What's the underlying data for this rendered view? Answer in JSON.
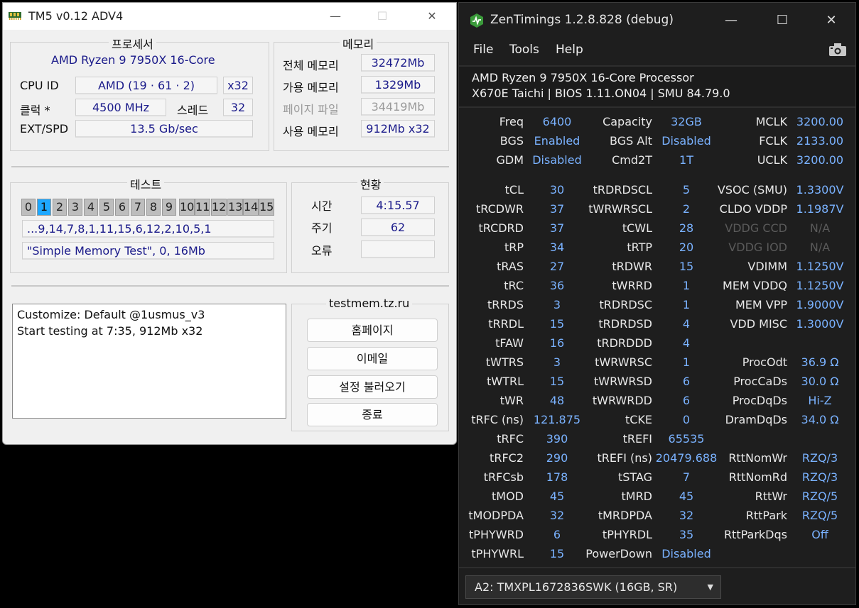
{
  "tm5": {
    "title": "TM5 v0.12 ADV4",
    "minimize": "—",
    "maximize": "☐",
    "close": "✕",
    "processor": {
      "group": "프로세서",
      "name": "AMD Ryzen 9 7950X 16-Core",
      "cpu_id_label": "CPU ID",
      "cpu_id": "AMD  (19 · 61 · 2)",
      "arch": "x32",
      "clock_label": "클럭 *",
      "clock": "4500 MHz",
      "threads_label": "스레드",
      "threads": "32",
      "ext_label": "EXT/SPD",
      "ext": "13.5 Gb/sec"
    },
    "memory": {
      "group": "메모리",
      "total_label": "전체 메모리",
      "total": "32472Mb",
      "avail_label": "가용 메모리",
      "avail": "1329Mb",
      "page_label": "페이지 파일",
      "page": "34419Mb",
      "used_label": "사용 메모리",
      "used": "912Mb x32"
    },
    "tests": {
      "group": "테스트",
      "cells": [
        "0",
        "1",
        "2",
        "3",
        "4",
        "5",
        "6",
        "7",
        "8",
        "9",
        "10",
        "11",
        "12",
        "13",
        "14",
        "15"
      ],
      "active_index": 1,
      "sequence": "...9,14,7,8,1,11,15,6,12,2,10,5,1",
      "config": "\"Simple Memory Test\", 0, 16Mb"
    },
    "status": {
      "group": "현황",
      "time_label": "시간",
      "time": "4:15.57",
      "cycle_label": "주기",
      "cycle": "62",
      "errors_label": "오류",
      "errors": ""
    },
    "log": [
      "Customize: Default @1usmus_v3",
      "Start testing at 7:35, 912Mb x32"
    ],
    "links": {
      "group": "testmem.tz.ru",
      "homepage": "홈페이지",
      "email": "이메일",
      "load_settings": "설정 불러오기",
      "exit": "종료"
    }
  },
  "zen": {
    "title": "ZenTimings 1.2.8.828 (debug)",
    "minimize": "—",
    "maximize": "☐",
    "close": "✕",
    "menu": [
      "File",
      "Tools",
      "Help"
    ],
    "cpu": "AMD Ryzen 9 7950X 16-Core Processor",
    "board": "X670E Taichi | BIOS 1.11.ON04 | SMU 84.79.0",
    "top": [
      [
        "Freq",
        "6400",
        "Capacity",
        "32GB",
        "MCLK",
        "3200.00"
      ],
      [
        "BGS",
        "Enabled",
        "BGS Alt",
        "Disabled",
        "FCLK",
        "2133.00"
      ],
      [
        "GDM",
        "Disabled",
        "Cmd2T",
        "1T",
        "UCLK",
        "3200.00"
      ]
    ],
    "timings": [
      [
        "tCL",
        "30",
        "tRDRDSCL",
        "5",
        "VSOC (SMU)",
        "1.3300V"
      ],
      [
        "tRCDWR",
        "37",
        "tWRWRSCL",
        "2",
        "CLDO VDDP",
        "1.1987V"
      ],
      [
        "tRCDRD",
        "37",
        "tCWL",
        "28",
        "VDDG CCD",
        "N/A"
      ],
      [
        "tRP",
        "34",
        "tRTP",
        "20",
        "VDDG IOD",
        "N/A"
      ],
      [
        "tRAS",
        "27",
        "tRDWR",
        "15",
        "VDIMM",
        "1.1250V"
      ],
      [
        "tRC",
        "36",
        "tWRRD",
        "1",
        "MEM VDDQ",
        "1.1250V"
      ],
      [
        "tRRDS",
        "3",
        "tRDRDSC",
        "1",
        "MEM VPP",
        "1.9000V"
      ],
      [
        "tRRDL",
        "15",
        "tRDRDSD",
        "4",
        "VDD MISC",
        "1.3000V"
      ],
      [
        "tFAW",
        "16",
        "tRDRDDD",
        "4",
        "",
        ""
      ],
      [
        "tWTRS",
        "3",
        "tWRWRSC",
        "1",
        "ProcOdt",
        "36.9 Ω"
      ],
      [
        "tWTRL",
        "15",
        "tWRWRSD",
        "6",
        "ProcCaDs",
        "30.0 Ω"
      ],
      [
        "tWR",
        "48",
        "tWRWRDD",
        "6",
        "ProcDqDs",
        "Hi-Z"
      ],
      [
        "tRFC (ns)",
        "121.875",
        "tCKE",
        "0",
        "DramDqDs",
        "34.0 Ω"
      ],
      [
        "tRFC",
        "390",
        "tREFI",
        "65535",
        "",
        ""
      ],
      [
        "tRFC2",
        "290",
        "tREFI (ns)",
        "20479.688",
        "RttNomWr",
        "RZQ/3"
      ],
      [
        "tRFCsb",
        "178",
        "tSTAG",
        "7",
        "RttNomRd",
        "RZQ/3"
      ],
      [
        "tMOD",
        "45",
        "tMRD",
        "45",
        "RttWr",
        "RZQ/5"
      ],
      [
        "tMODPDA",
        "32",
        "tMRDPDA",
        "32",
        "RttPark",
        "RZQ/5"
      ],
      [
        "tPHYWRD",
        "6",
        "tPHYRDL",
        "35",
        "RttParkDqs",
        "Off"
      ],
      [
        "tPHYWRL",
        "15",
        "PowerDown",
        "Disabled",
        "",
        ""
      ]
    ],
    "dim_rows": [
      2,
      3
    ],
    "dimm_select": "A2: TMXPL1672836SWK (16GB, SR)",
    "colors": {
      "value": "#7ab2ff",
      "label": "#e8e8e8",
      "dim": "#5a5a5a"
    }
  }
}
